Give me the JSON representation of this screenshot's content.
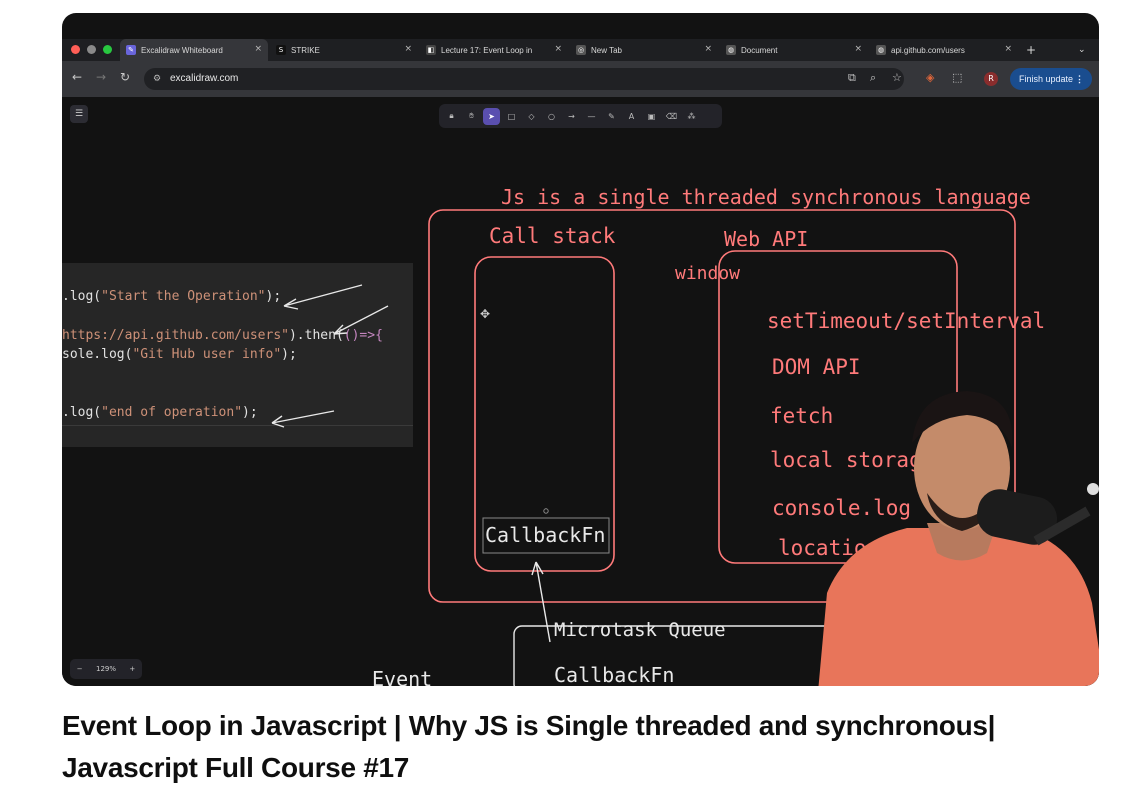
{
  "browser": {
    "tabs": [
      {
        "label": "Excalidraw Whiteboard",
        "icon": "excalidraw-icon",
        "active": true
      },
      {
        "label": "STRIKE",
        "icon": "strike-icon",
        "active": false
      },
      {
        "label": "Lecture 17: Event Loop in",
        "icon": "cursor-icon",
        "active": false
      },
      {
        "label": "New Tab",
        "icon": "chrome-icon",
        "active": false
      },
      {
        "label": "Document",
        "icon": "globe-icon",
        "active": false
      },
      {
        "label": "api.github.com/users",
        "icon": "globe-icon",
        "active": false
      }
    ],
    "url": "excalidraw.com",
    "profile_initial": "R",
    "finish_update_label": "Finish update"
  },
  "canvas": {
    "zoom_label": "129%",
    "code_lines": [
      {
        "plain": ".log(",
        "string": "\"Start the Operation\"",
        "tail": ");"
      },
      {
        "string": "https://api.github.com/users\"",
        "tail": ").then(",
        "kw": "()=>{"
      },
      {
        "plain": "sole.log(",
        "string": "\"Git Hub user info\"",
        "tail": ");"
      },
      {
        "plain": ".log(",
        "string": "\"end of operation\"",
        "tail": ");"
      }
    ],
    "heading": "Js is a single threaded synchronous language",
    "call_stack_label": "Call stack",
    "web_api_label": "Web API",
    "window_label": "window",
    "web_apis": [
      "setTimeout/setInterval",
      "DOM API",
      "fetch",
      "local storag",
      "console.log",
      "location"
    ],
    "callback_label": "CallbackFn",
    "microtask_label": "Microtask Queue",
    "microtask_item": "CallbackFn",
    "event_label": "Event"
  },
  "colors": {
    "accent_red": "#ff7a7a",
    "canvas_bg": "#121212",
    "finish_update_bg": "#1a4d8f"
  },
  "video_title": "Event Loop in Javascript | Why JS is Single threaded and synchronous| Javascript Full Course #17"
}
